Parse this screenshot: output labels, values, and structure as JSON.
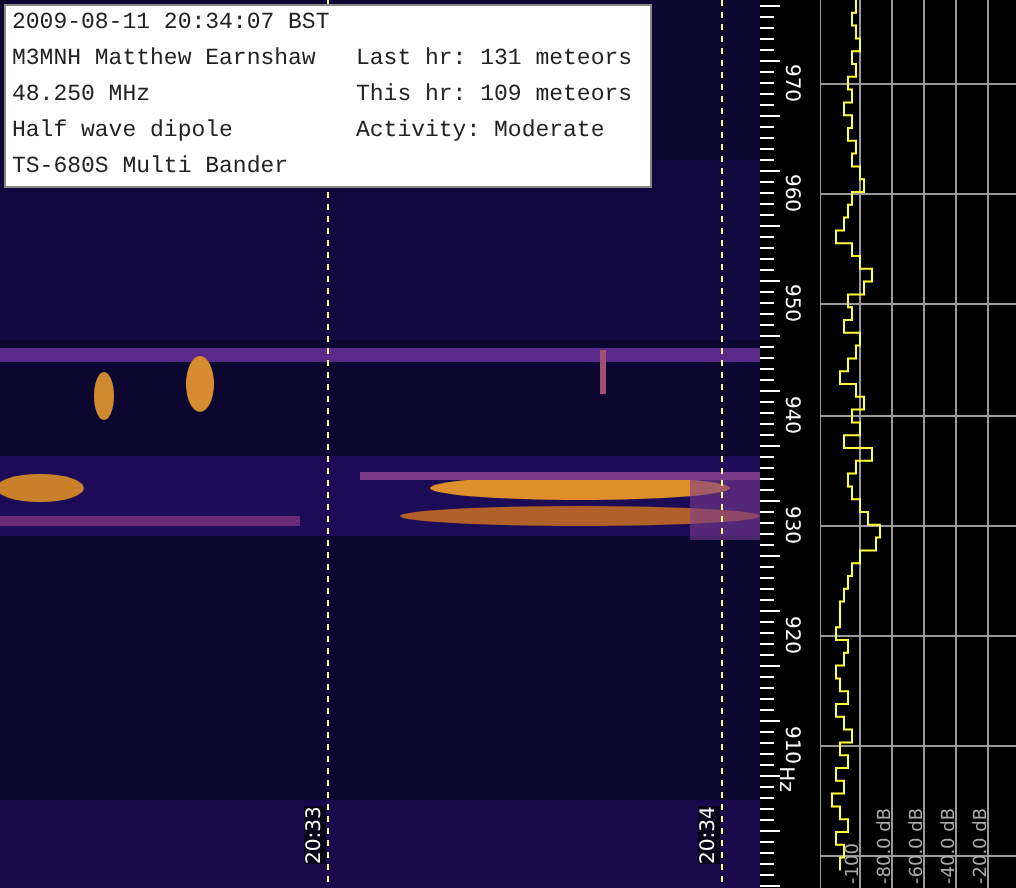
{
  "info_box": {
    "timestamp": "2009-08-11 20:34:07 BST",
    "station": "M3MNH Matthew Earnshaw",
    "frequency": "48.250 MHz",
    "antenna": "Half wave dipole",
    "receiver": "TS-680S Multi Bander",
    "last_hour": "Last hr: 131 meteors",
    "this_hour": "This hr: 109 meteors",
    "activity": "Activity: Moderate"
  },
  "time_markers": [
    "20:33",
    "20:34"
  ],
  "frequency_scale": {
    "labels": [
      "970",
      "960",
      "950",
      "940",
      "930",
      "920",
      "910"
    ],
    "unit": "Hz"
  },
  "level_scale": {
    "labels": [
      "-100",
      "-80.0 dB",
      "-60.0 dB",
      "-40.0 dB",
      "-20.0 dB"
    ]
  }
}
